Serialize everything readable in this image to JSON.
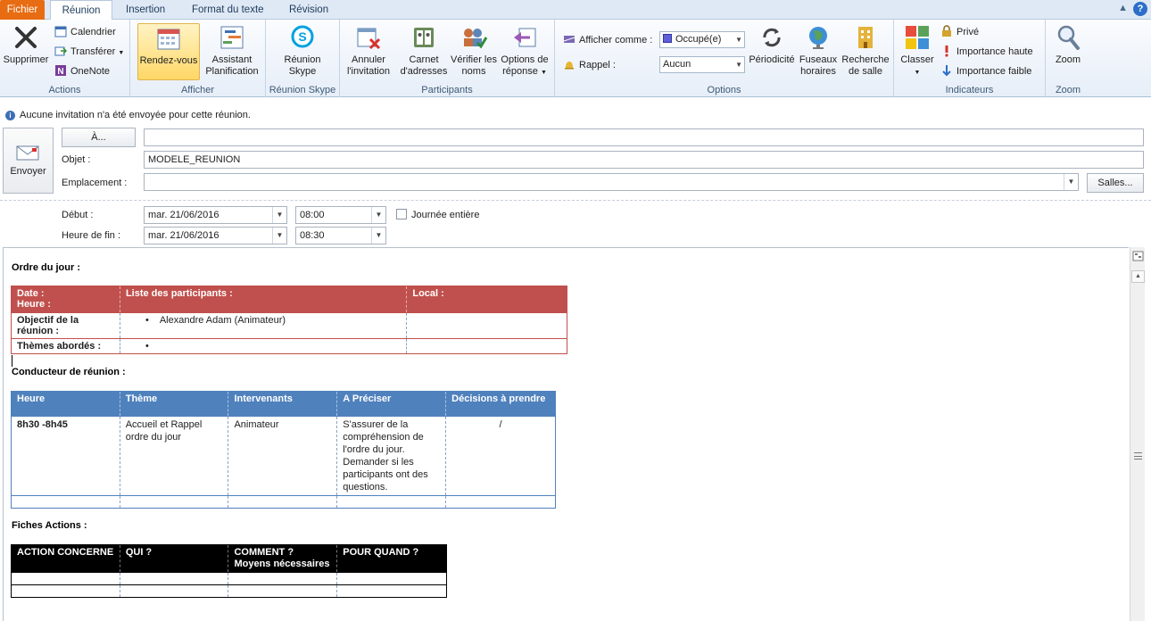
{
  "tabs": [
    "Fichier",
    "Réunion",
    "Insertion",
    "Format du texte",
    "Révision"
  ],
  "ribbon": {
    "actions": {
      "label": "Actions",
      "supprimer": "Supprimer",
      "calendrier": "Calendrier",
      "transferer": "Transférer",
      "onenote": "OneNote"
    },
    "afficher": {
      "label": "Afficher",
      "rendezvous": "Rendez-vous",
      "assistant": "Assistant Planification"
    },
    "skype": {
      "label": "Réunion Skype",
      "reunion": "Réunion Skype"
    },
    "participants": {
      "label": "Participants",
      "annuler": "Annuler l'invitation",
      "carnet": "Carnet d'adresses",
      "verifier": "Vérifier les noms",
      "options": "Options de réponse"
    },
    "options": {
      "label": "Options",
      "afficher_comme": "Afficher comme :",
      "afficher_value": "Occupé(e)",
      "rappel": "Rappel :",
      "rappel_value": "Aucun",
      "periodicite": "Périodicité",
      "fuseaux": "Fuseaux horaires",
      "recherche": "Recherche de salle"
    },
    "indicateurs": {
      "label": "Indicateurs",
      "classer": "Classer",
      "prive": "Privé",
      "haute": "Importance haute",
      "faible": "Importance faible"
    },
    "zoom": {
      "label": "Zoom",
      "zoom": "Zoom"
    }
  },
  "info": "Aucune invitation n'a été envoyée pour cette réunion.",
  "form": {
    "envoyer": "Envoyer",
    "a_button": "À...",
    "objet_label": "Objet :",
    "objet_value": "MODELE_REUNION",
    "emplacement_label": "Emplacement :",
    "salles": "Salles...",
    "debut_label": "Début :",
    "debut_date": "mar. 21/06/2016",
    "debut_time": "08:00",
    "journee": "Journée entière",
    "fin_label": "Heure de fin :",
    "fin_date": "mar. 21/06/2016",
    "fin_time": "08:30"
  },
  "body": {
    "ordre_title": "Ordre du jour :",
    "t1": {
      "h1": "Date :",
      "h1b": "Heure :",
      "h2": "Liste des participants :",
      "h3": "Local :",
      "r1_label": "Objectif de la réunion :",
      "r1_participant": "Alexandre Adam (Animateur)",
      "r2_label": "Thèmes abordés :"
    },
    "conducteur_title": "Conducteur de réunion :",
    "t2": {
      "headers": [
        "Heure",
        "Thème",
        "Intervenants",
        "A Préciser",
        "Décisions à prendre"
      ],
      "row": [
        "8h30 -8h45",
        "Accueil et Rappel ordre du jour",
        "Animateur",
        "S'assurer de la compréhension de l'ordre du jour. Demander si les participants ont des questions.",
        "/"
      ]
    },
    "fiches_title": "Fiches Actions :",
    "t3": {
      "headers": [
        "ACTION CONCERNE",
        "QUI ?",
        "COMMENT ?",
        "POUR QUAND ?"
      ],
      "h3b": "Moyens nécessaires"
    }
  }
}
